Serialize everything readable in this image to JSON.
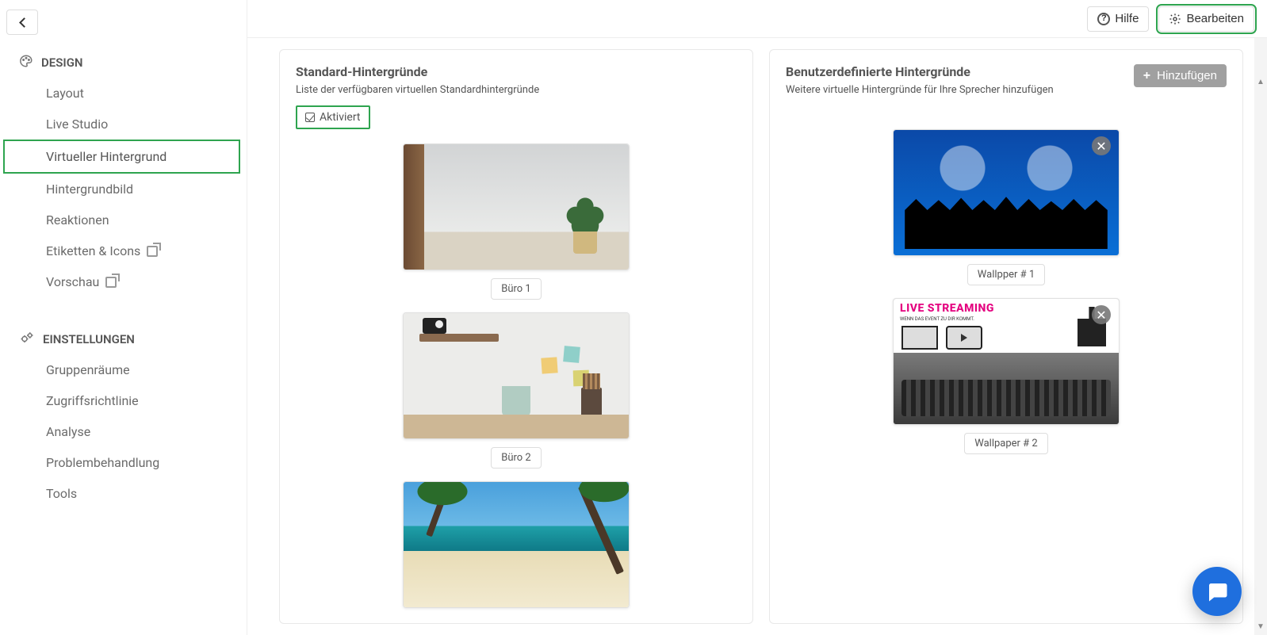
{
  "sidebar": {
    "section_design": "DESIGN",
    "section_settings": "EINSTELLUNGEN",
    "items_design": [
      {
        "label": "Layout"
      },
      {
        "label": "Live Studio"
      },
      {
        "label": "Virtueller Hintergrund"
      },
      {
        "label": "Hintergrundbild"
      },
      {
        "label": "Reaktionen"
      },
      {
        "label": "Etiketten & Icons"
      },
      {
        "label": "Vorschau"
      }
    ],
    "items_settings": [
      {
        "label": "Gruppenräume"
      },
      {
        "label": "Zugriffsrichtlinie"
      },
      {
        "label": "Analyse"
      },
      {
        "label": "Problembehandlung"
      },
      {
        "label": "Tools"
      }
    ]
  },
  "topbar": {
    "help_label": "Hilfe",
    "edit_label": "Bearbeiten"
  },
  "standard": {
    "title": "Standard-Hintergründe",
    "desc": "Liste der verfügbaren virtuellen Standardhintergründe",
    "activated_label": "Aktiviert",
    "items": [
      {
        "label": "Büro 1"
      },
      {
        "label": "Büro 2"
      }
    ]
  },
  "custom": {
    "title": "Benutzerdefinierte Hintergründe",
    "desc": "Weitere virtuelle Hintergründe für Ihre Sprecher hinzufügen",
    "add_label": "Hinzufügen",
    "items": [
      {
        "label": "Wallpper # 1"
      },
      {
        "label": "Wallpaper # 2"
      }
    ],
    "live_title": "LIVE STREAMING",
    "live_sub": "WENN DAS EVENT ZU DIR KOMMT."
  }
}
